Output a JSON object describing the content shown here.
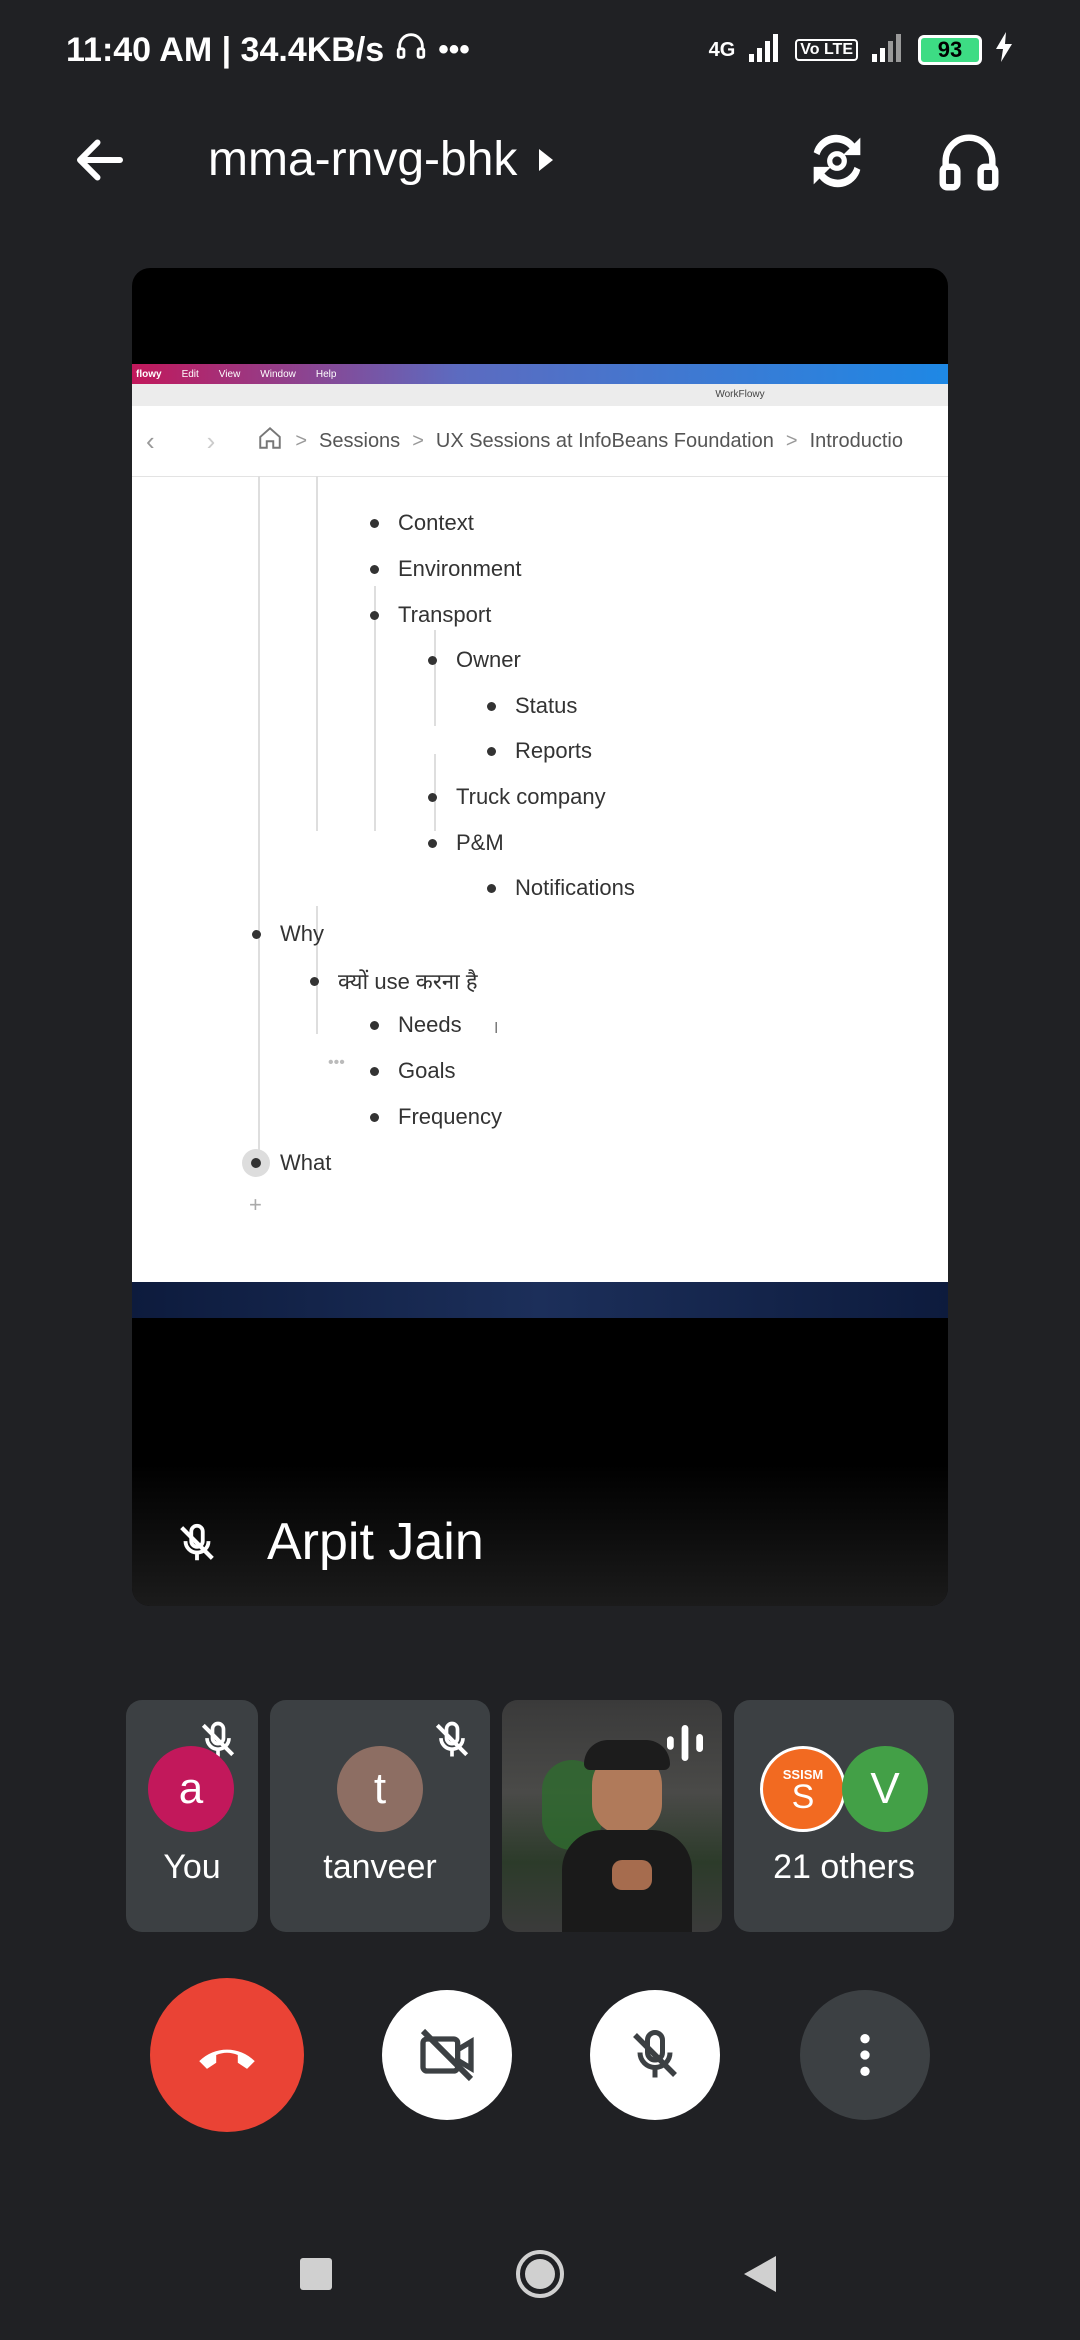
{
  "status_bar": {
    "time": "11:40 AM | 34.4KB/s",
    "net_label": "4G",
    "volte_label": "Vo LTE",
    "battery": "93"
  },
  "header": {
    "meeting_code": "mma-rnvg-bhk"
  },
  "presentation": {
    "menu": [
      "flowy",
      "Edit",
      "View",
      "Window",
      "Help"
    ],
    "app_title": "WorkFlowy",
    "breadcrumbs": [
      "Sessions",
      "UX Sessions at InfoBeans Foundation",
      "Introductio"
    ],
    "items": [
      {
        "label": "Context"
      },
      {
        "label": "Environment"
      },
      {
        "label": "Transport"
      },
      {
        "label": "Owner"
      },
      {
        "label": "Status"
      },
      {
        "label": "Reports"
      },
      {
        "label": "Truck company"
      },
      {
        "label": "P&M"
      },
      {
        "label": "Notifications"
      },
      {
        "label": "Why"
      },
      {
        "label": "क्यों use करना है"
      },
      {
        "label": "Needs"
      },
      {
        "label": "Goals"
      },
      {
        "label": "Frequency"
      },
      {
        "label": "What"
      }
    ]
  },
  "presenter": {
    "name": "Arpit Jain"
  },
  "participants": [
    {
      "initial": "a",
      "name": "You",
      "color": "#c2185b"
    },
    {
      "initial": "t",
      "name": "tanveer",
      "color": "#8d6e63"
    },
    {
      "name": "",
      "video": true
    },
    {
      "initial": "V",
      "name": "21 others",
      "color": "#43a047",
      "logo_text": "SSISM"
    }
  ],
  "colors": {
    "end_call": "#ea4335",
    "background": "#202124",
    "tile": "#3c4043"
  }
}
